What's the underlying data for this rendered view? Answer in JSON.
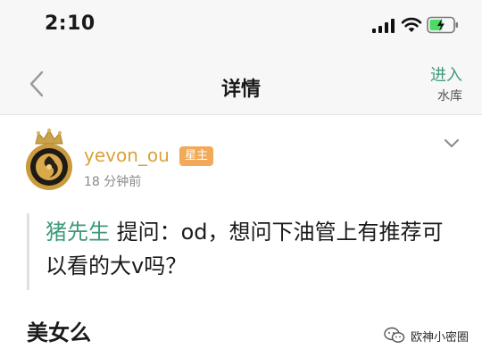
{
  "status_bar": {
    "time": "2:10"
  },
  "nav": {
    "title": "详情",
    "enter_main": "进入",
    "enter_sub": "水库"
  },
  "post": {
    "username": "yevon_ou",
    "owner_badge": "星主",
    "time": "18 分钟前",
    "question": {
      "asker": "猪先生",
      "text": " 提问：od，想问下油管上有推荐可以看的大v吗？"
    },
    "comment": "美女么"
  },
  "watermark": {
    "text": "欧神小密圈"
  },
  "colors": {
    "accent_green": "#3d9a7c",
    "username_gold": "#d9a23a",
    "badge_orange": "#f2a95a"
  }
}
